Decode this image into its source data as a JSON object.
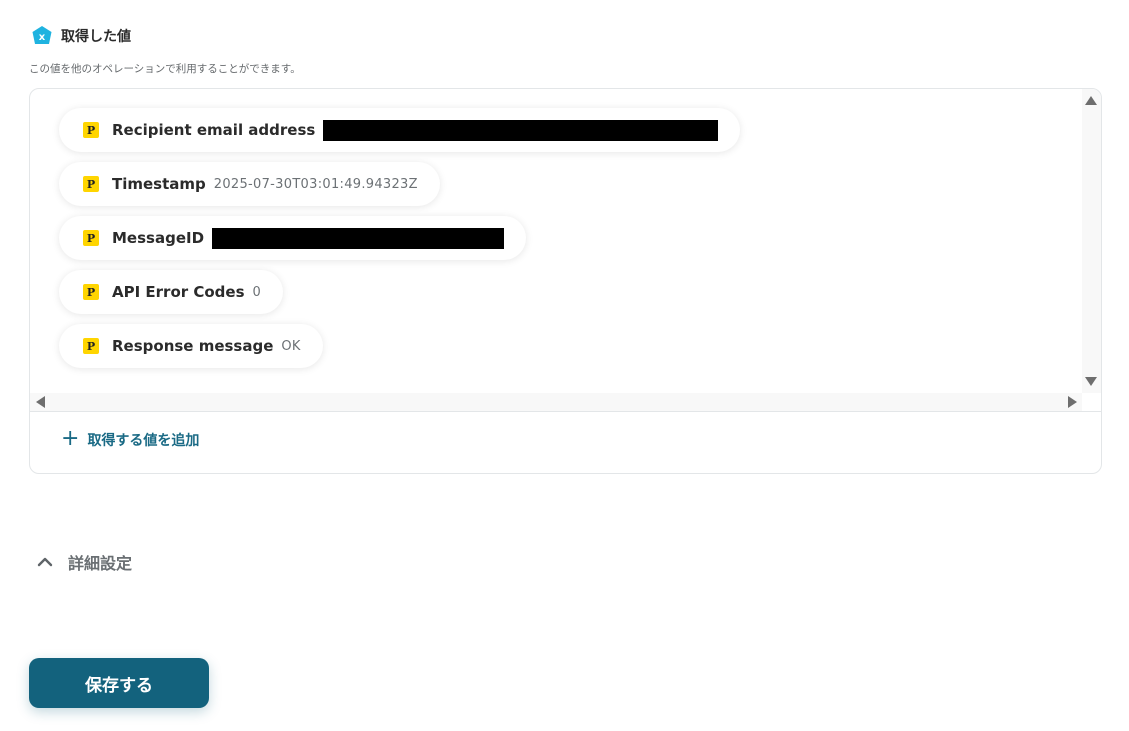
{
  "section": {
    "title": "取得した値",
    "description": "この値を他のオペレーションで利用することができます。",
    "icon": "x-badge-icon"
  },
  "values": [
    {
      "label": "Recipient email address",
      "value": "",
      "redacted": true
    },
    {
      "label": "Timestamp",
      "value": "2025-07-30T03:01:49.94323Z",
      "redacted": false
    },
    {
      "label": "MessageID",
      "value": "",
      "redacted": true
    },
    {
      "label": "API Error Codes",
      "value": "0",
      "redacted": false
    },
    {
      "label": "Response message",
      "value": "OK",
      "redacted": false
    }
  ],
  "chip_icon_letter": "P",
  "add_value_label": "取得する値を追加",
  "advanced_settings_label": "詳細設定",
  "save_button_label": "保存する",
  "colors": {
    "accent": "#13627d",
    "link": "#1a6a85",
    "chip_icon_bg": "#ffd500",
    "badge": "#1fb3e0"
  }
}
